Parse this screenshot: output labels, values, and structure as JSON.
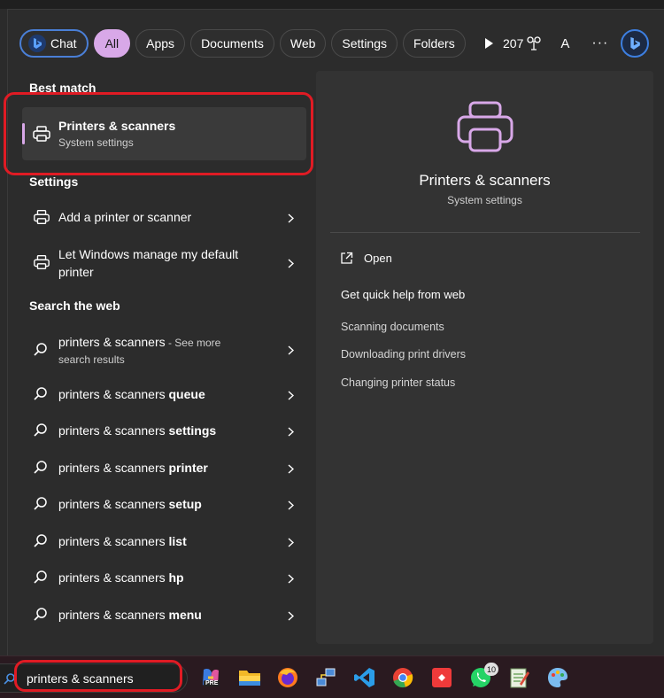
{
  "filters": {
    "items": [
      "Chat",
      "All",
      "Apps",
      "Documents",
      "Web",
      "Settings",
      "Folders"
    ],
    "active": "All"
  },
  "topbar": {
    "points": "207",
    "avatar_letter": "A",
    "more": "···"
  },
  "best_match": {
    "heading": "Best match",
    "title": "Printers & scanners",
    "subtitle": "System settings"
  },
  "settings_section": {
    "heading": "Settings",
    "items": [
      {
        "line1": "Add a printer or scanner",
        "line2": ""
      },
      {
        "line1": "Let Windows manage my default",
        "line2": "printer"
      }
    ]
  },
  "web_section": {
    "heading": "Search the web",
    "first": {
      "prefix": "printers & scanners",
      "hint1": " - See more",
      "hint2": "search results"
    },
    "items": [
      {
        "prefix": "printers & scanners ",
        "bold": "queue"
      },
      {
        "prefix": "printers & scanners ",
        "bold": "settings"
      },
      {
        "prefix": "printers & scanners ",
        "bold": "printer"
      },
      {
        "prefix": "printers & scanners ",
        "bold": "setup"
      },
      {
        "prefix": "printers & scanners ",
        "bold": "list"
      },
      {
        "prefix": "printers & scanners ",
        "bold": "hp"
      },
      {
        "prefix": "printers & scanners ",
        "bold": "menu"
      }
    ]
  },
  "detail": {
    "title": "Printers & scanners",
    "subtitle": "System settings",
    "open_label": "Open",
    "quick_help": "Get quick help from web",
    "links": [
      "Scanning documents",
      "Downloading print drivers",
      "Changing printer status"
    ]
  },
  "taskbar": {
    "search_value": "printers & scanners",
    "copilot_badge": "PRE",
    "whatsapp_badge": "10"
  },
  "colors": {
    "accent": "#d8a8e8",
    "highlight_box": "#e01b24",
    "bing_blue": "#3d7fe0"
  }
}
